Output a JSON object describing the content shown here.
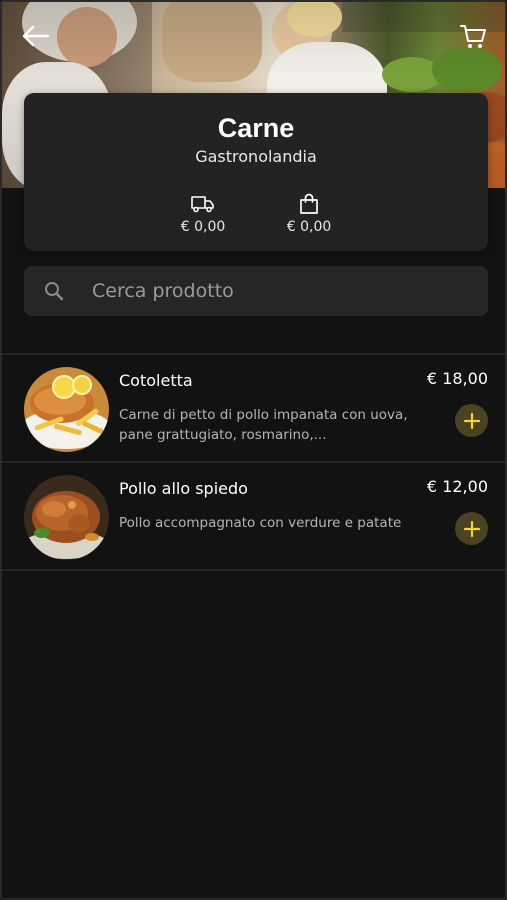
{
  "header": {
    "back_icon": "arrow-left-icon",
    "cart_icon": "cart-icon"
  },
  "store": {
    "category_title": "Carne",
    "store_name": "Gastronolandia",
    "delivery_icon": "truck-icon",
    "delivery_fee": "€ 0,00",
    "bag_icon": "shopping-bag-icon",
    "min_order": "€ 0,00"
  },
  "search": {
    "icon": "search-icon",
    "placeholder": "Cerca prodotto",
    "value": ""
  },
  "products": [
    {
      "name": "Cotoletta",
      "price": "€ 18,00",
      "description": "Carne di petto di pollo impanata con uova, pane grattugiato, rosmarino,...",
      "add_icon": "plus-icon"
    },
    {
      "name": "Pollo allo spiedo",
      "price": "€ 12,00",
      "description": "Pollo accompagnato con verdure e patate",
      "add_icon": "plus-icon"
    }
  ],
  "colors": {
    "background": "#121212",
    "card": "#232323",
    "accent": "#f2d33a",
    "accent_bg": "#4a4220"
  }
}
